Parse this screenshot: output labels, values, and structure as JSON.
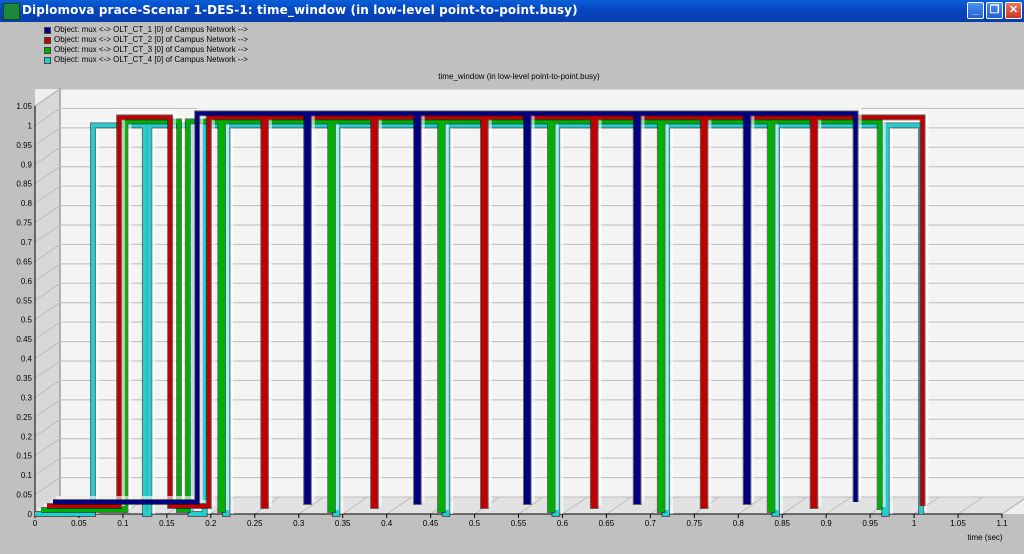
{
  "window": {
    "title": "Diplomova prace-Scenar 1-DES-1: time_window (in low-level point-to-point.busy)",
    "buttons": {
      "minimize": "_",
      "restore": "❐",
      "close": "✕"
    }
  },
  "legend": {
    "items": [
      {
        "label": "Object: mux <-> OLT_CT_1 [0] of Campus Network -->",
        "color": "#000080"
      },
      {
        "label": "Object: mux <-> OLT_CT_2 [0] of Campus Network -->",
        "color": "#c00000"
      },
      {
        "label": "Object: mux <-> OLT_CT_3 [0] of Campus Network -->",
        "color": "#00b000"
      },
      {
        "label": "Object: mux <-> OLT_CT_4 [0] of Campus Network -->",
        "color": "#20d0d0"
      }
    ]
  },
  "chart_data": {
    "type": "line",
    "title": "time_window (in low-level point-to-point.busy)",
    "xlabel": "time (sec)",
    "ylabel": "",
    "xlim": [
      0,
      1.1
    ],
    "ylim": [
      0,
      1.05
    ],
    "x_ticks": [
      "0",
      "0.05",
      "0.1",
      "0.15",
      "0.2",
      "0.25",
      "0.3",
      "0.35",
      "0.4",
      "0.45",
      "0.5",
      "0.55",
      "0.6",
      "0.65",
      "0.7",
      "0.75",
      "0.8",
      "0.85",
      "0.9",
      "0.95",
      "1",
      "1.05",
      "1.1"
    ],
    "y_ticks": [
      "0",
      "0.05",
      "0.1",
      "0.15",
      "0.2",
      "0.25",
      "0.3",
      "0.35",
      "0.4",
      "0.45",
      "0.5",
      "0.55",
      "0.6",
      "0.65",
      "0.7",
      "0.75",
      "0.8",
      "0.85",
      "0.9",
      "0.95",
      "1",
      "1.05"
    ],
    "grid": true,
    "colors": {
      "plot_bg": "#ffffff",
      "wall": "#eeeeee",
      "frame": "#777777",
      "grid": "#bdbdbd"
    },
    "series": [
      {
        "name": "Object: mux <-> OLT_CT_1 [0] of Campus Network -->",
        "color": "#000080",
        "busy_intervals": [
          [
            0.164,
            0.288
          ],
          [
            0.291,
            0.413
          ],
          [
            0.416,
            0.538
          ],
          [
            0.541,
            0.663
          ],
          [
            0.666,
            0.788
          ],
          [
            0.791,
            0.913
          ]
        ]
      },
      {
        "name": "Object: mux <-> OLT_CT_2 [0] of Campus Network -->",
        "color": "#c00000",
        "busy_intervals": [
          [
            0.082,
            0.14
          ],
          [
            0.184,
            0.246
          ],
          [
            0.249,
            0.371
          ],
          [
            0.374,
            0.496
          ],
          [
            0.499,
            0.621
          ],
          [
            0.624,
            0.746
          ],
          [
            0.749,
            0.871
          ],
          [
            0.874,
            0.996
          ]
        ]
      },
      {
        "name": "Object: mux <-> OLT_CT_3 [0] of Campus Network -->",
        "color": "#00b000",
        "busy_intervals": [
          [
            0.096,
            0.157
          ],
          [
            0.167,
            0.204
          ],
          [
            0.207,
            0.329
          ],
          [
            0.332,
            0.454
          ],
          [
            0.457,
            0.579
          ],
          [
            0.582,
            0.704
          ],
          [
            0.707,
            0.829
          ],
          [
            0.832,
            0.954
          ]
        ]
      },
      {
        "name": "Object: mux <-> OLT_CT_4 [0] of Campus Network -->",
        "color": "#20d0d0",
        "busy_intervals": [
          [
            0.066,
            0.125
          ],
          [
            0.13,
            0.177
          ],
          [
            0.193,
            0.216
          ],
          [
            0.219,
            0.341
          ],
          [
            0.344,
            0.466
          ],
          [
            0.469,
            0.591
          ],
          [
            0.594,
            0.716
          ],
          [
            0.719,
            0.841
          ],
          [
            0.844,
            0.966
          ],
          [
            0.969,
            1.008
          ]
        ]
      }
    ]
  }
}
